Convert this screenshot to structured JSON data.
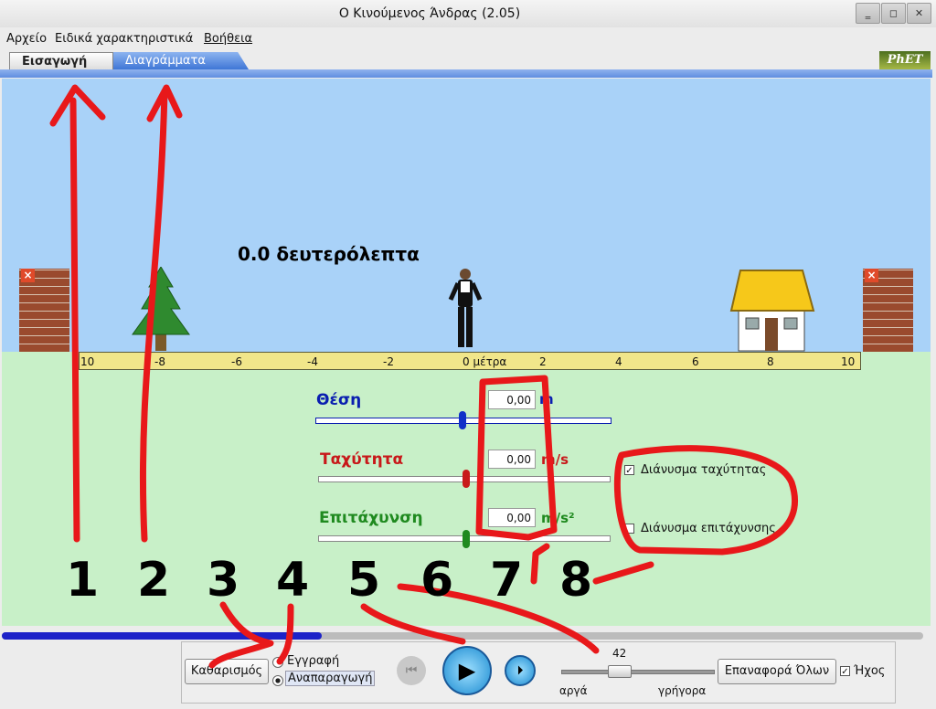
{
  "window": {
    "title": "Ο Κινούμενος Άνδρας (2.05)",
    "min": "‗",
    "max": "◻",
    "close": "✕"
  },
  "menu": [
    {
      "label": "Αρχείο"
    },
    {
      "label": "Ειδικά χαρακτηριστικά"
    },
    {
      "label": "Βοήθεια"
    }
  ],
  "tabs": [
    {
      "label": "Εισαγωγή"
    },
    {
      "label": "Διαγράμματα"
    }
  ],
  "logo": "PhET",
  "scene": {
    "time_text": "0.0 δευτερόλεπτα",
    "ruler_ticks": [
      "10",
      "-8",
      "-6",
      "-4",
      "-2",
      "0 μέτρα",
      "2",
      "4",
      "6",
      "8",
      "10"
    ]
  },
  "controls": {
    "position": {
      "label": "Θέση",
      "value": "0,00",
      "unit": "m",
      "color": "#0a1eb0"
    },
    "velocity": {
      "label": "Ταχύτητα",
      "value": "0,00",
      "unit": "m/s",
      "color": "#c8181a"
    },
    "acceleration": {
      "label": "Επιτάχυνση",
      "value": "0,00",
      "unit": "m/s²",
      "color": "#1f8a1f"
    },
    "show_velocity_vector": {
      "label": "Διάνυσμα ταχύτητας",
      "checked": true
    },
    "show_acceleration_vector": {
      "label": "Διάνυσμα επιτάχυνσης",
      "checked": false
    }
  },
  "playback": {
    "clear_label": "Καθαρισμός",
    "record_label": "Εγγραφή",
    "playback_label": "Αναπαραγωγή",
    "speed_value": "42",
    "slow_label": "αργά",
    "fast_label": "γρήγορα",
    "reset_all_label": "Επαναφορά Όλων",
    "sound_label": "Ήχος",
    "sound_checked": true,
    "progress": 0.34
  },
  "annotations": [
    "1",
    "2",
    "3",
    "4",
    "5",
    "6",
    "7",
    "8"
  ],
  "colors": {
    "sky": "#a9d2f8",
    "ground": "#c8f0c8",
    "annotation": "#e8181a",
    "tab_active": "#4a7fd8"
  }
}
